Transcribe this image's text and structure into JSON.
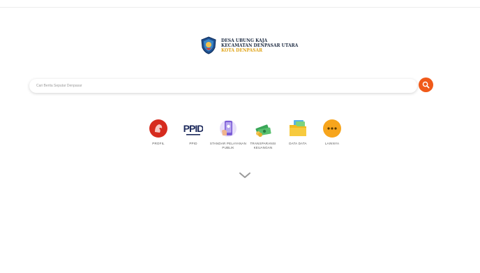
{
  "brand": {
    "line1": "DESA UBUNG KAJA",
    "line2": "KECAMATAN DENPASAR UTARA",
    "line3": "KOTA DENPASAR",
    "emblem_icon": "denpasar-emblem-icon"
  },
  "search": {
    "placeholder": "Cari Berita Seputar Denpasar",
    "value": "",
    "button_icon": "search-icon",
    "button_color": "#f05a1a"
  },
  "menu": [
    {
      "label": "PROFIL",
      "icon": "profil-icon",
      "color": "#d62b1e"
    },
    {
      "label": "PPID",
      "icon": "ppid-logo-icon",
      "color": "#1d2a5c"
    },
    {
      "label": "STANDAR PELAYANAN PUBLIK",
      "icon": "phone-service-icon",
      "color": "#7b5cd6"
    },
    {
      "label": "TRANSPARANSI KEUANGAN",
      "icon": "money-icon",
      "color": "#3aa657"
    },
    {
      "label": "DATA DATA",
      "icon": "folder-icon",
      "color": "#f2b91d"
    },
    {
      "label": "LAINNYA",
      "icon": "more-icon",
      "color": "#f7a51c"
    }
  ],
  "scroll_down_icon": "chevron-down-icon"
}
